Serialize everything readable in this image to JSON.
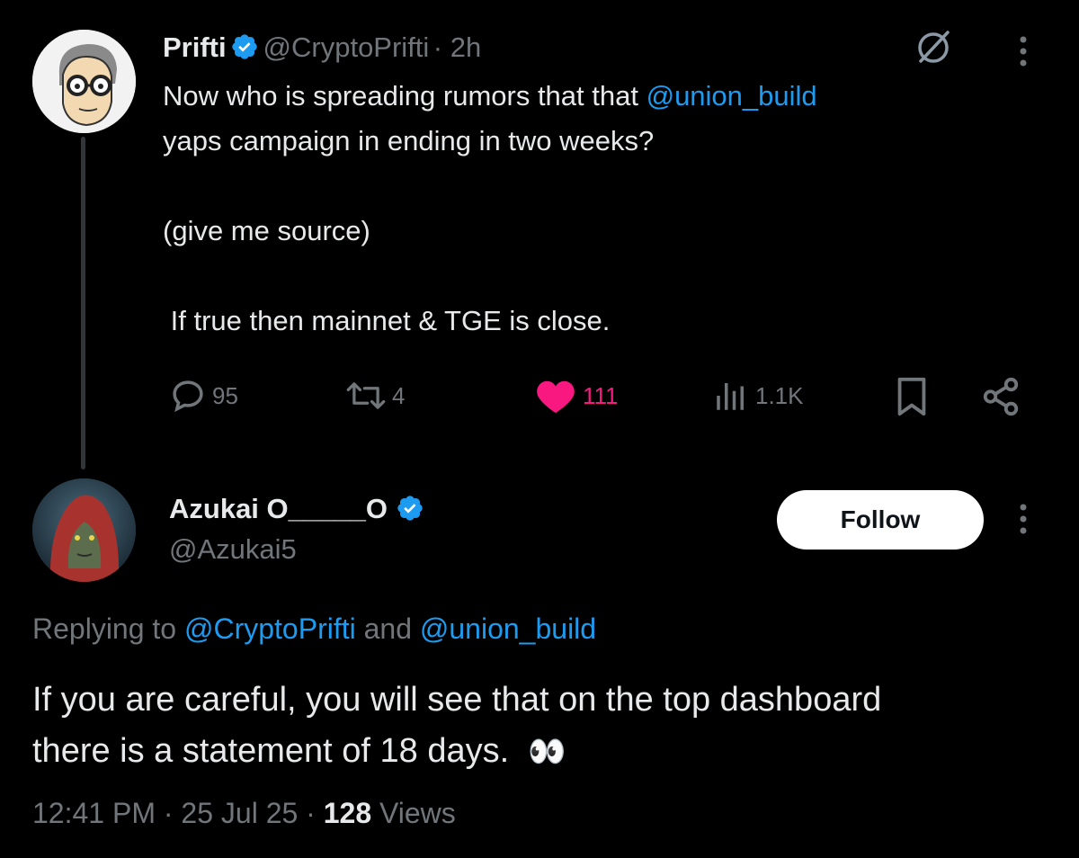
{
  "original_tweet": {
    "author_name": "Prifti",
    "author_handle": "@CryptoPrifti",
    "time_ago": "· 2h",
    "text_line1_pre": "Now who is spreading rumors that that ",
    "text_line1_mention": "@union_build",
    "text_line2": "yaps campaign in ending in two weeks?",
    "text_line3": "(give me source)",
    "text_line4": " If true then mainnet & TGE is close.",
    "stats": {
      "replies": "95",
      "reposts": "4",
      "likes": "111",
      "views": "1.1K"
    }
  },
  "reply_tweet": {
    "author_name": "Azukai O_____O",
    "author_handle": "@Azukai5",
    "follow_label": "Follow",
    "replying_prefix": "Replying to ",
    "replying_to_1": "@CryptoPrifti",
    "replying_and": " and ",
    "replying_to_2": "@union_build",
    "text_line1": "If you are careful, you will see that on the top dashboard",
    "text_line2": "there is a statement of 18 days.",
    "emoji": "👀",
    "time": "12:41 PM",
    "date": "25 Jul 25",
    "views_count": "128",
    "views_label": "Views"
  },
  "colors": {
    "background": "#000000",
    "text": "#e7e9ea",
    "secondary": "#71767b",
    "link": "#1d9bf0",
    "like": "#f91880"
  }
}
